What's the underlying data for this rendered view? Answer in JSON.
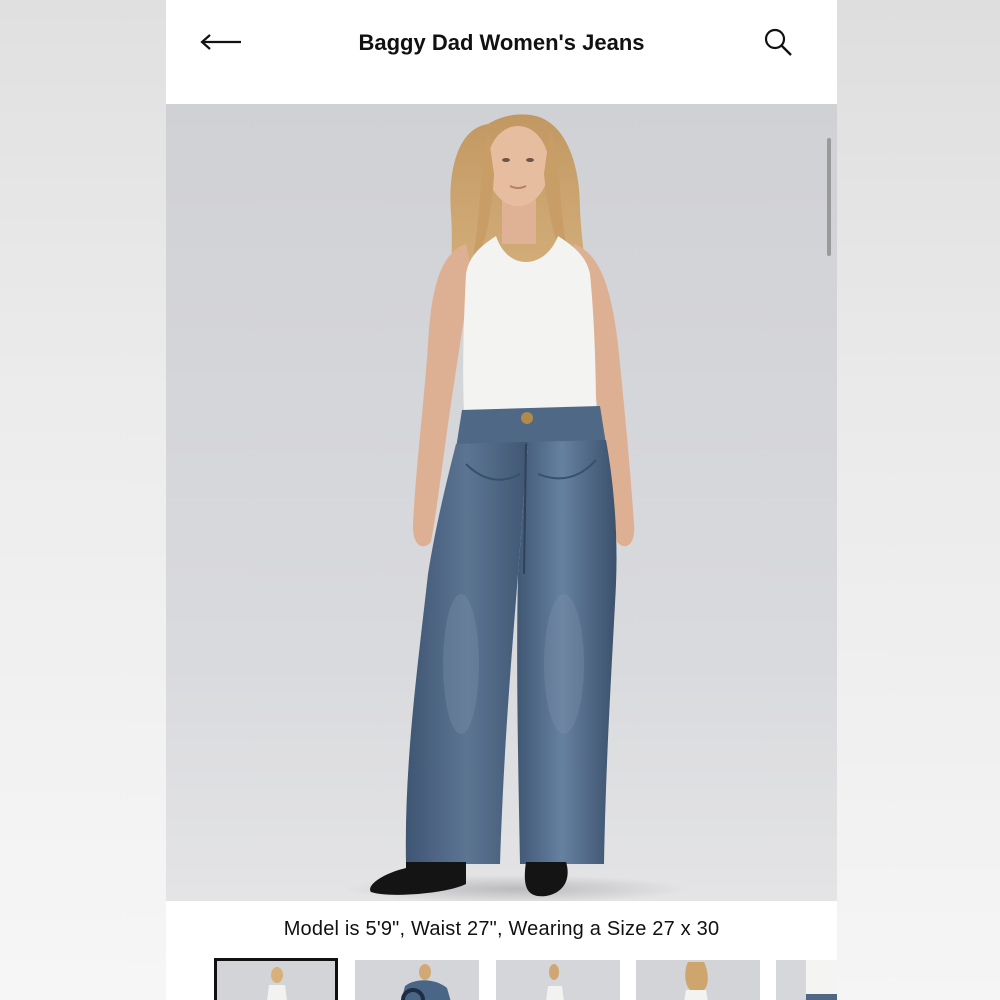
{
  "header": {
    "title": "Baggy Dad Women's Jeans",
    "back_icon": "arrow-left-icon",
    "search_icon": "search-icon"
  },
  "product_image": {
    "alt": "Model wearing Baggy Dad Women's Jeans with white tank top"
  },
  "caption": "Model is 5'9\", Waist 27\", Wearing a Size 27 x 30",
  "thumbnails": [
    {
      "label": "Front view",
      "selected": true
    },
    {
      "label": "Side view with jacket",
      "selected": false
    },
    {
      "label": "Side view",
      "selected": false
    },
    {
      "label": "Back view",
      "selected": false
    },
    {
      "label": "Detail view",
      "selected": false
    }
  ],
  "colors": {
    "denim": "#4e6785",
    "denim_dark": "#3a506c",
    "tank": "#f4f4f2",
    "skin": "#e3b89c",
    "hair": "#c9a06a",
    "background": "#d5d6da"
  }
}
